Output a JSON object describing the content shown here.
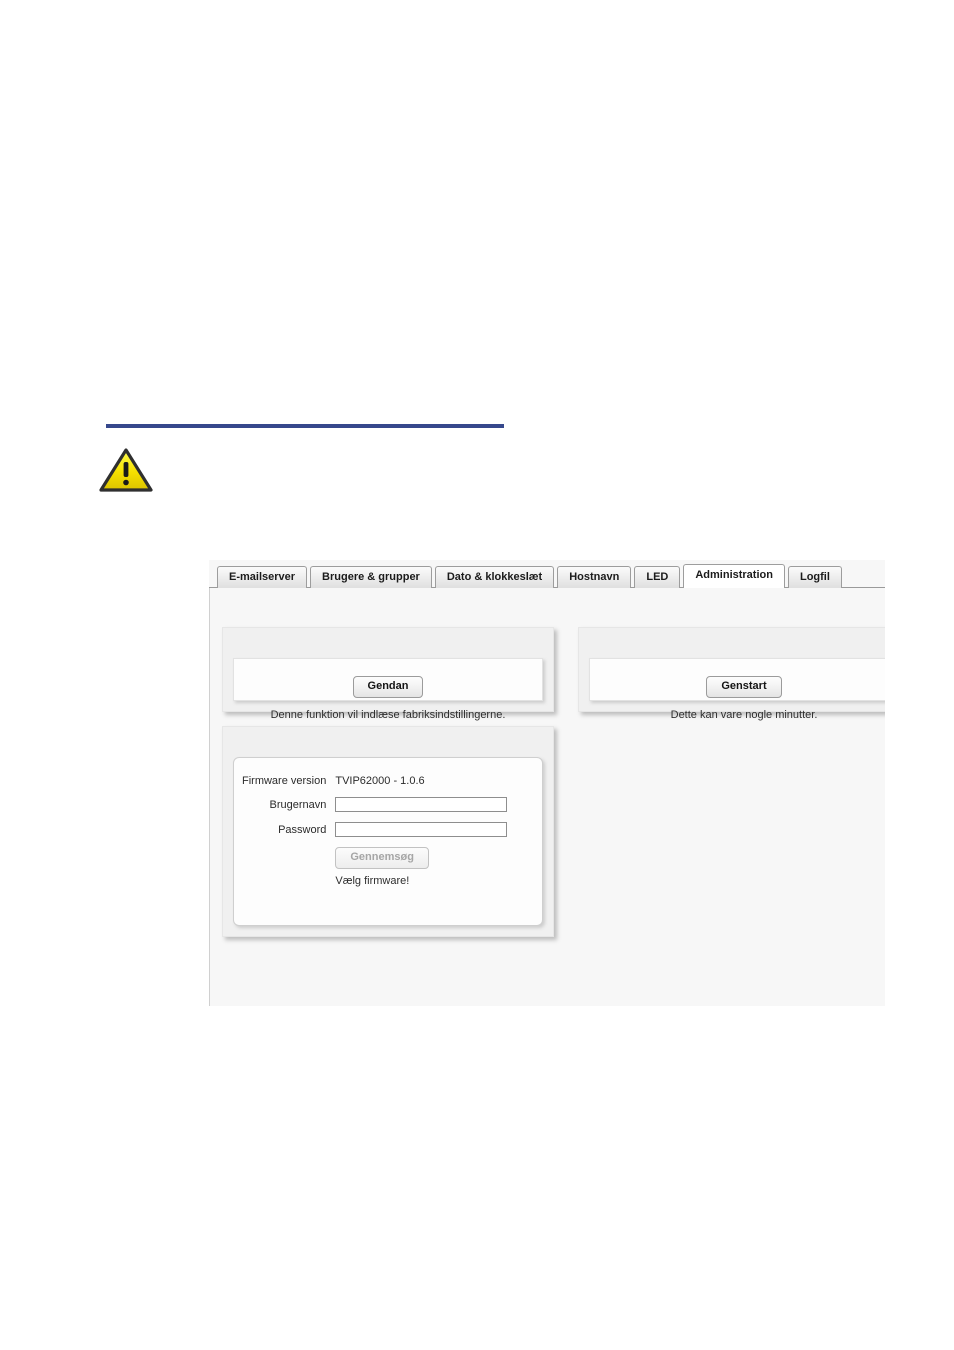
{
  "document": {
    "rule_color": "#36488c",
    "warning_icon": "warning-triangle-icon"
  },
  "browser": {
    "tabs": [
      {
        "label": "E-mailserver",
        "active": false
      },
      {
        "label": "Brugere & grupper",
        "active": false
      },
      {
        "label": "Dato & klokkeslæt",
        "active": false
      },
      {
        "label": "Hostnavn",
        "active": false
      },
      {
        "label": "LED",
        "active": false
      },
      {
        "label": "Administration",
        "active": true
      },
      {
        "label": "Logfil",
        "active": false
      }
    ]
  },
  "panels": {
    "restore": {
      "button_label": "Gendan",
      "caption": "Denne funktion vil indlæse fabriksindstillingerne."
    },
    "restart": {
      "button_label": "Genstart",
      "caption": "Dette kan vare nogle minutter."
    },
    "firmware": {
      "version_label": "Firmware version",
      "version_value": "TVIP62000 - 1.0.6",
      "username_label": "Brugernavn",
      "username_value": "",
      "username_placeholder": "",
      "password_label": "Password",
      "password_value": "",
      "password_placeholder": "",
      "browse_label": "Gennemsøg",
      "browse_disabled": true,
      "note": "Vælg firmware!"
    }
  }
}
